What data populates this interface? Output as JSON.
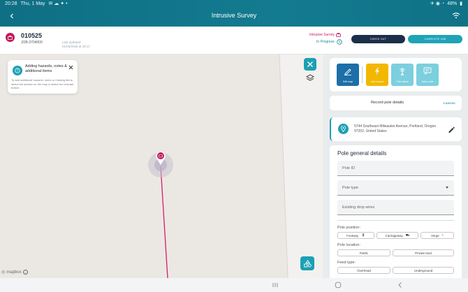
{
  "status_bar": {
    "time": "20:28",
    "date": "Thu, 1 May",
    "battery": "48%"
  },
  "header": {
    "title": "Intrusive Survey"
  },
  "job": {
    "id": "010525",
    "ref": "JOB-3704000",
    "last_updated_label": "Last updated:",
    "last_updated_value": "01/05/2025 at 19:17",
    "survey_link": "Intrusive Survey",
    "status": "In Progress",
    "check_out": "CHECK OUT",
    "complete_job": "COMPLETE JOB"
  },
  "map_hint": {
    "title": "Adding hazards, notes & additional items",
    "body": "To add additional hazards, notes or missing items, select the section on the map & select the relevant button."
  },
  "map": {
    "attribution": "mapbox"
  },
  "tools": [
    {
      "label": "Edit map",
      "icon": "pencil-icon"
    },
    {
      "label": "Add hazard",
      "icon": "hazard-icon"
    },
    {
      "label": "Pole status",
      "icon": "pole-icon"
    },
    {
      "label": "Add a note",
      "icon": "note-icon"
    }
  ],
  "record": {
    "label": "Record pole details",
    "cancel": "CANCEL"
  },
  "address": {
    "text": "5744 Southeast Milwaukie Avenue, Portland, Oregon 97202, United States"
  },
  "form": {
    "title": "Pole general details",
    "pole_id_placeholder": "Pole ID",
    "pole_type_placeholder": "Pole type",
    "drop_wires_placeholder": "Existing drop wires",
    "position_label": "Pole position:",
    "position_options": [
      "Footway",
      "Carriageway",
      "Verge"
    ],
    "location_label": "Pole location:",
    "location_options": [
      "Public",
      "Private land"
    ],
    "feed_label": "Feed type:",
    "feed_options": [
      "Overhead",
      "Underground"
    ]
  },
  "colors": {
    "brand_teal": "#1ca0b3",
    "brand_magenta": "#c1185a",
    "navy": "#1c2e4a",
    "hazard_yellow": "#f2b800"
  }
}
